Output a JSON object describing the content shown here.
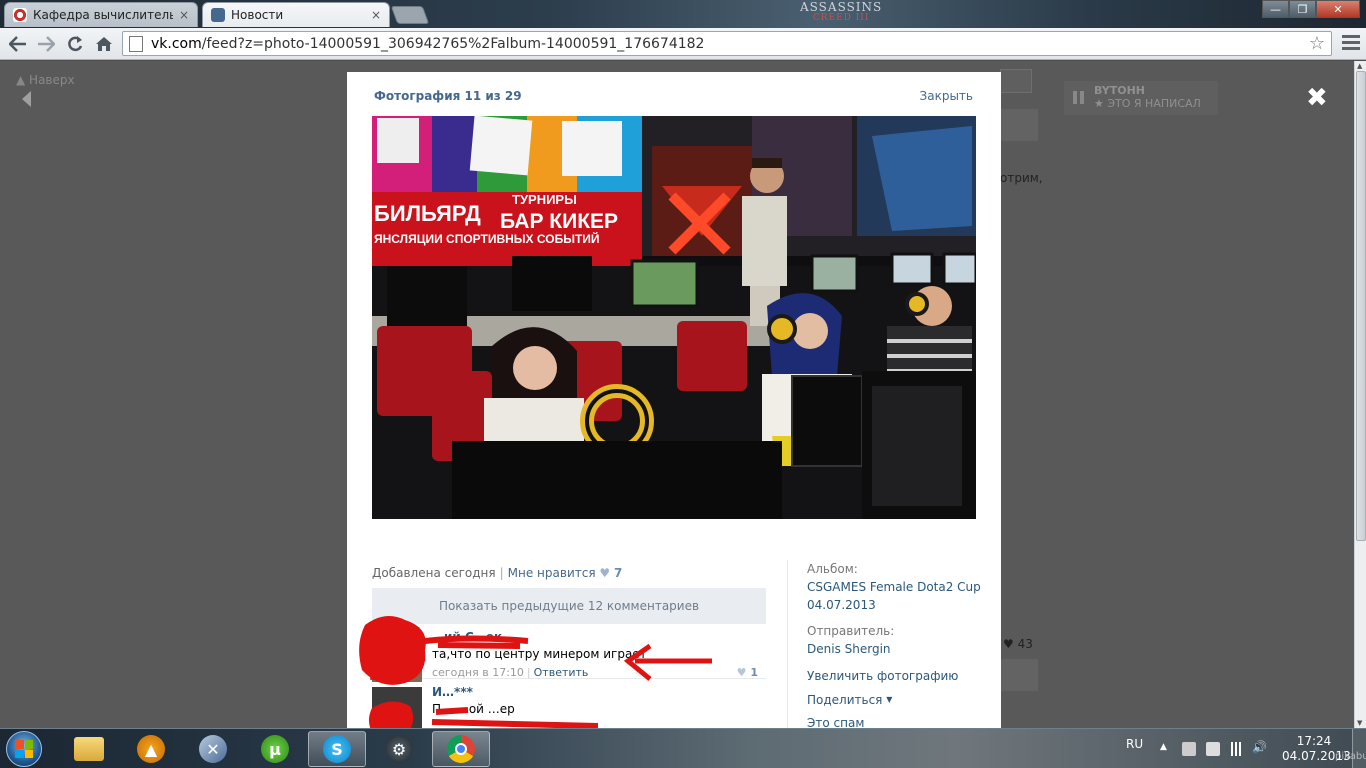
{
  "browser": {
    "tabs": [
      {
        "title": "Кафедра вычислительно",
        "close": "×",
        "active": false
      },
      {
        "title": "Новости",
        "close": "×",
        "active": true
      }
    ],
    "wallpaper_logo": "ASSASSINS",
    "wallpaper_logo_sub": "CREED III",
    "window_buttons": {
      "minimize": "—",
      "restore": "❐",
      "close": "✕"
    },
    "address": {
      "domain": "vk.com",
      "path": "/feed?z=photo-14000591_306942765%2Falbum-14000591_176674182"
    },
    "nav_icons": [
      "back-icon",
      "forward-icon",
      "reload-icon",
      "home-icon",
      "star-icon",
      "menu-icon"
    ]
  },
  "page": {
    "up_link": "Наверх",
    "background_text": "отрим,",
    "background_likes": "♥ 43",
    "sidebar_player": {
      "title": "BYTOHH",
      "subtitle": "★ ЭТО Я НАПИСАЛ"
    },
    "overlay_close": "✖"
  },
  "photo_viewer": {
    "counter": "Фотография 11 из 29",
    "close_label": "Закрыть",
    "photo_signs": {
      "sign1": "БИЛЬЯРД",
      "sign2": "ТУРНИРЫ",
      "sign3": "БАР КИКЕР",
      "sign4": "ЯНСЛЯЦИИ СПОРТИВНЫХ СОБЫТИЙ"
    },
    "added": "Добавлена сегодня",
    "like_label": "Мне нравится",
    "like_heart": "♥",
    "like_count": "7",
    "show_previous": "Показать предыдущие 12 комментариев",
    "comments": [
      {
        "author": "…ий С…ек",
        "text": "та,что по центру минером играет",
        "date": "сегодня в 17:10",
        "reply": "Ответить",
        "likes": "1"
      },
      {
        "author": "И…***",
        "text": "П… …ой …ер",
        "date": "",
        "reply": "",
        "likes": ""
      }
    ],
    "sidebar": {
      "album_label": "Альбом:",
      "album_name": "CSGAMES Female Dota2 Cup 04.07.2013",
      "sender_label": "Отправитель:",
      "sender_name": "Denis Shergin",
      "enlarge": "Увеличить фотографию",
      "share": "Поделиться",
      "spam": "Это спам"
    }
  },
  "taskbar": {
    "apps": [
      "explorer-icon",
      "aimp-icon",
      "tool-icon",
      "utorrent-icon",
      "skype-icon",
      "steam-icon",
      "chrome-icon"
    ],
    "lang": "RU",
    "time": "17:24",
    "date": "04.07.2013",
    "watermark": "pikabu.ru"
  },
  "colors": {
    "vk_link": "#2b587a",
    "vk_header": "#45688e",
    "overlay": "#595959"
  }
}
